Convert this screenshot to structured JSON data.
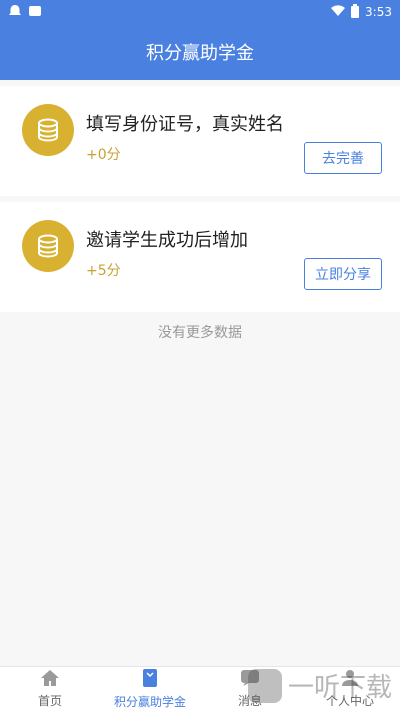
{
  "status": {
    "time": "3:53"
  },
  "header": {
    "title": "积分赢助学金"
  },
  "tasks": [
    {
      "title": "填写身份证号，真实姓名",
      "points": "+0分",
      "action": "去完善"
    },
    {
      "title": "邀请学生成功后增加",
      "points": "+5分",
      "action": "立即分享"
    }
  ],
  "list": {
    "empty": "没有更多数据"
  },
  "tabbar": {
    "items": [
      {
        "label": "首页",
        "icon": "home-icon"
      },
      {
        "label": "积分赢助学金",
        "icon": "scholarship-icon"
      },
      {
        "label": "消息",
        "icon": "message-icon"
      },
      {
        "label": "个人中心",
        "icon": "user-icon"
      }
    ]
  },
  "watermark": {
    "text": "一听下载"
  }
}
